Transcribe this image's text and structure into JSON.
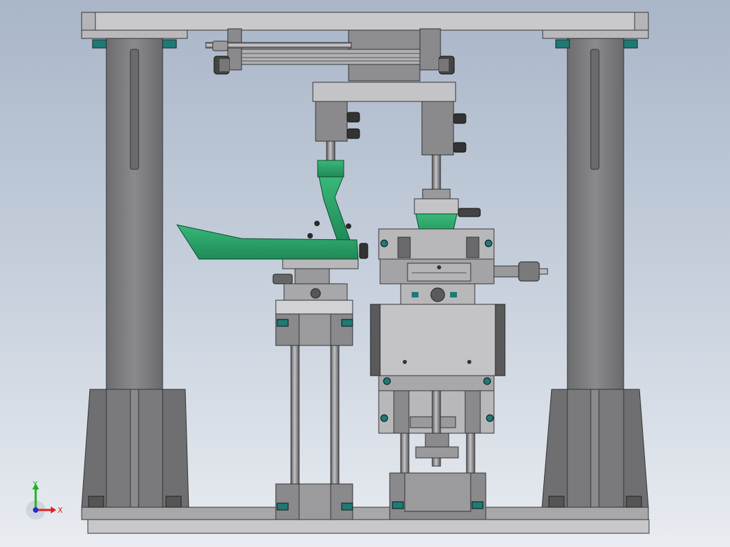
{
  "view": {
    "background_top": "#a9b6c8",
    "background_bottom": "#e9ecf1",
    "metal_color": "#7f7f82",
    "dark_metal_color": "#4a4a4c",
    "light_metal_color": "#c7c7c9",
    "accent_green": "#2ea86e",
    "accent_teal": "#1f7f78"
  },
  "triad": {
    "x_label": "X",
    "y_label": "Y",
    "x_color": "#e02020",
    "y_color": "#20b020",
    "z_color": "#2030d0"
  }
}
